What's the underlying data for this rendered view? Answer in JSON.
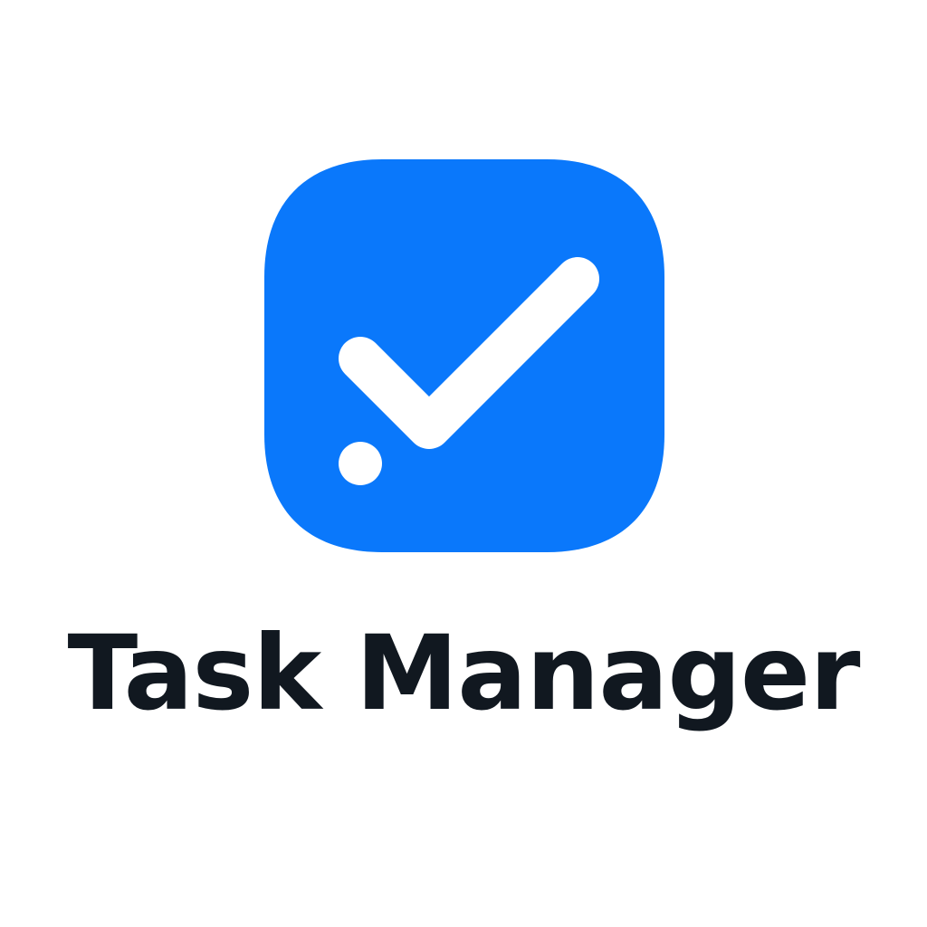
{
  "app": {
    "name": "Task Manager",
    "icon": "checkmark-icon"
  },
  "colors": {
    "background": "#ffffff",
    "icon_background": "#0a78fb",
    "icon_glyph": "#ffffff",
    "text": "#111820"
  }
}
